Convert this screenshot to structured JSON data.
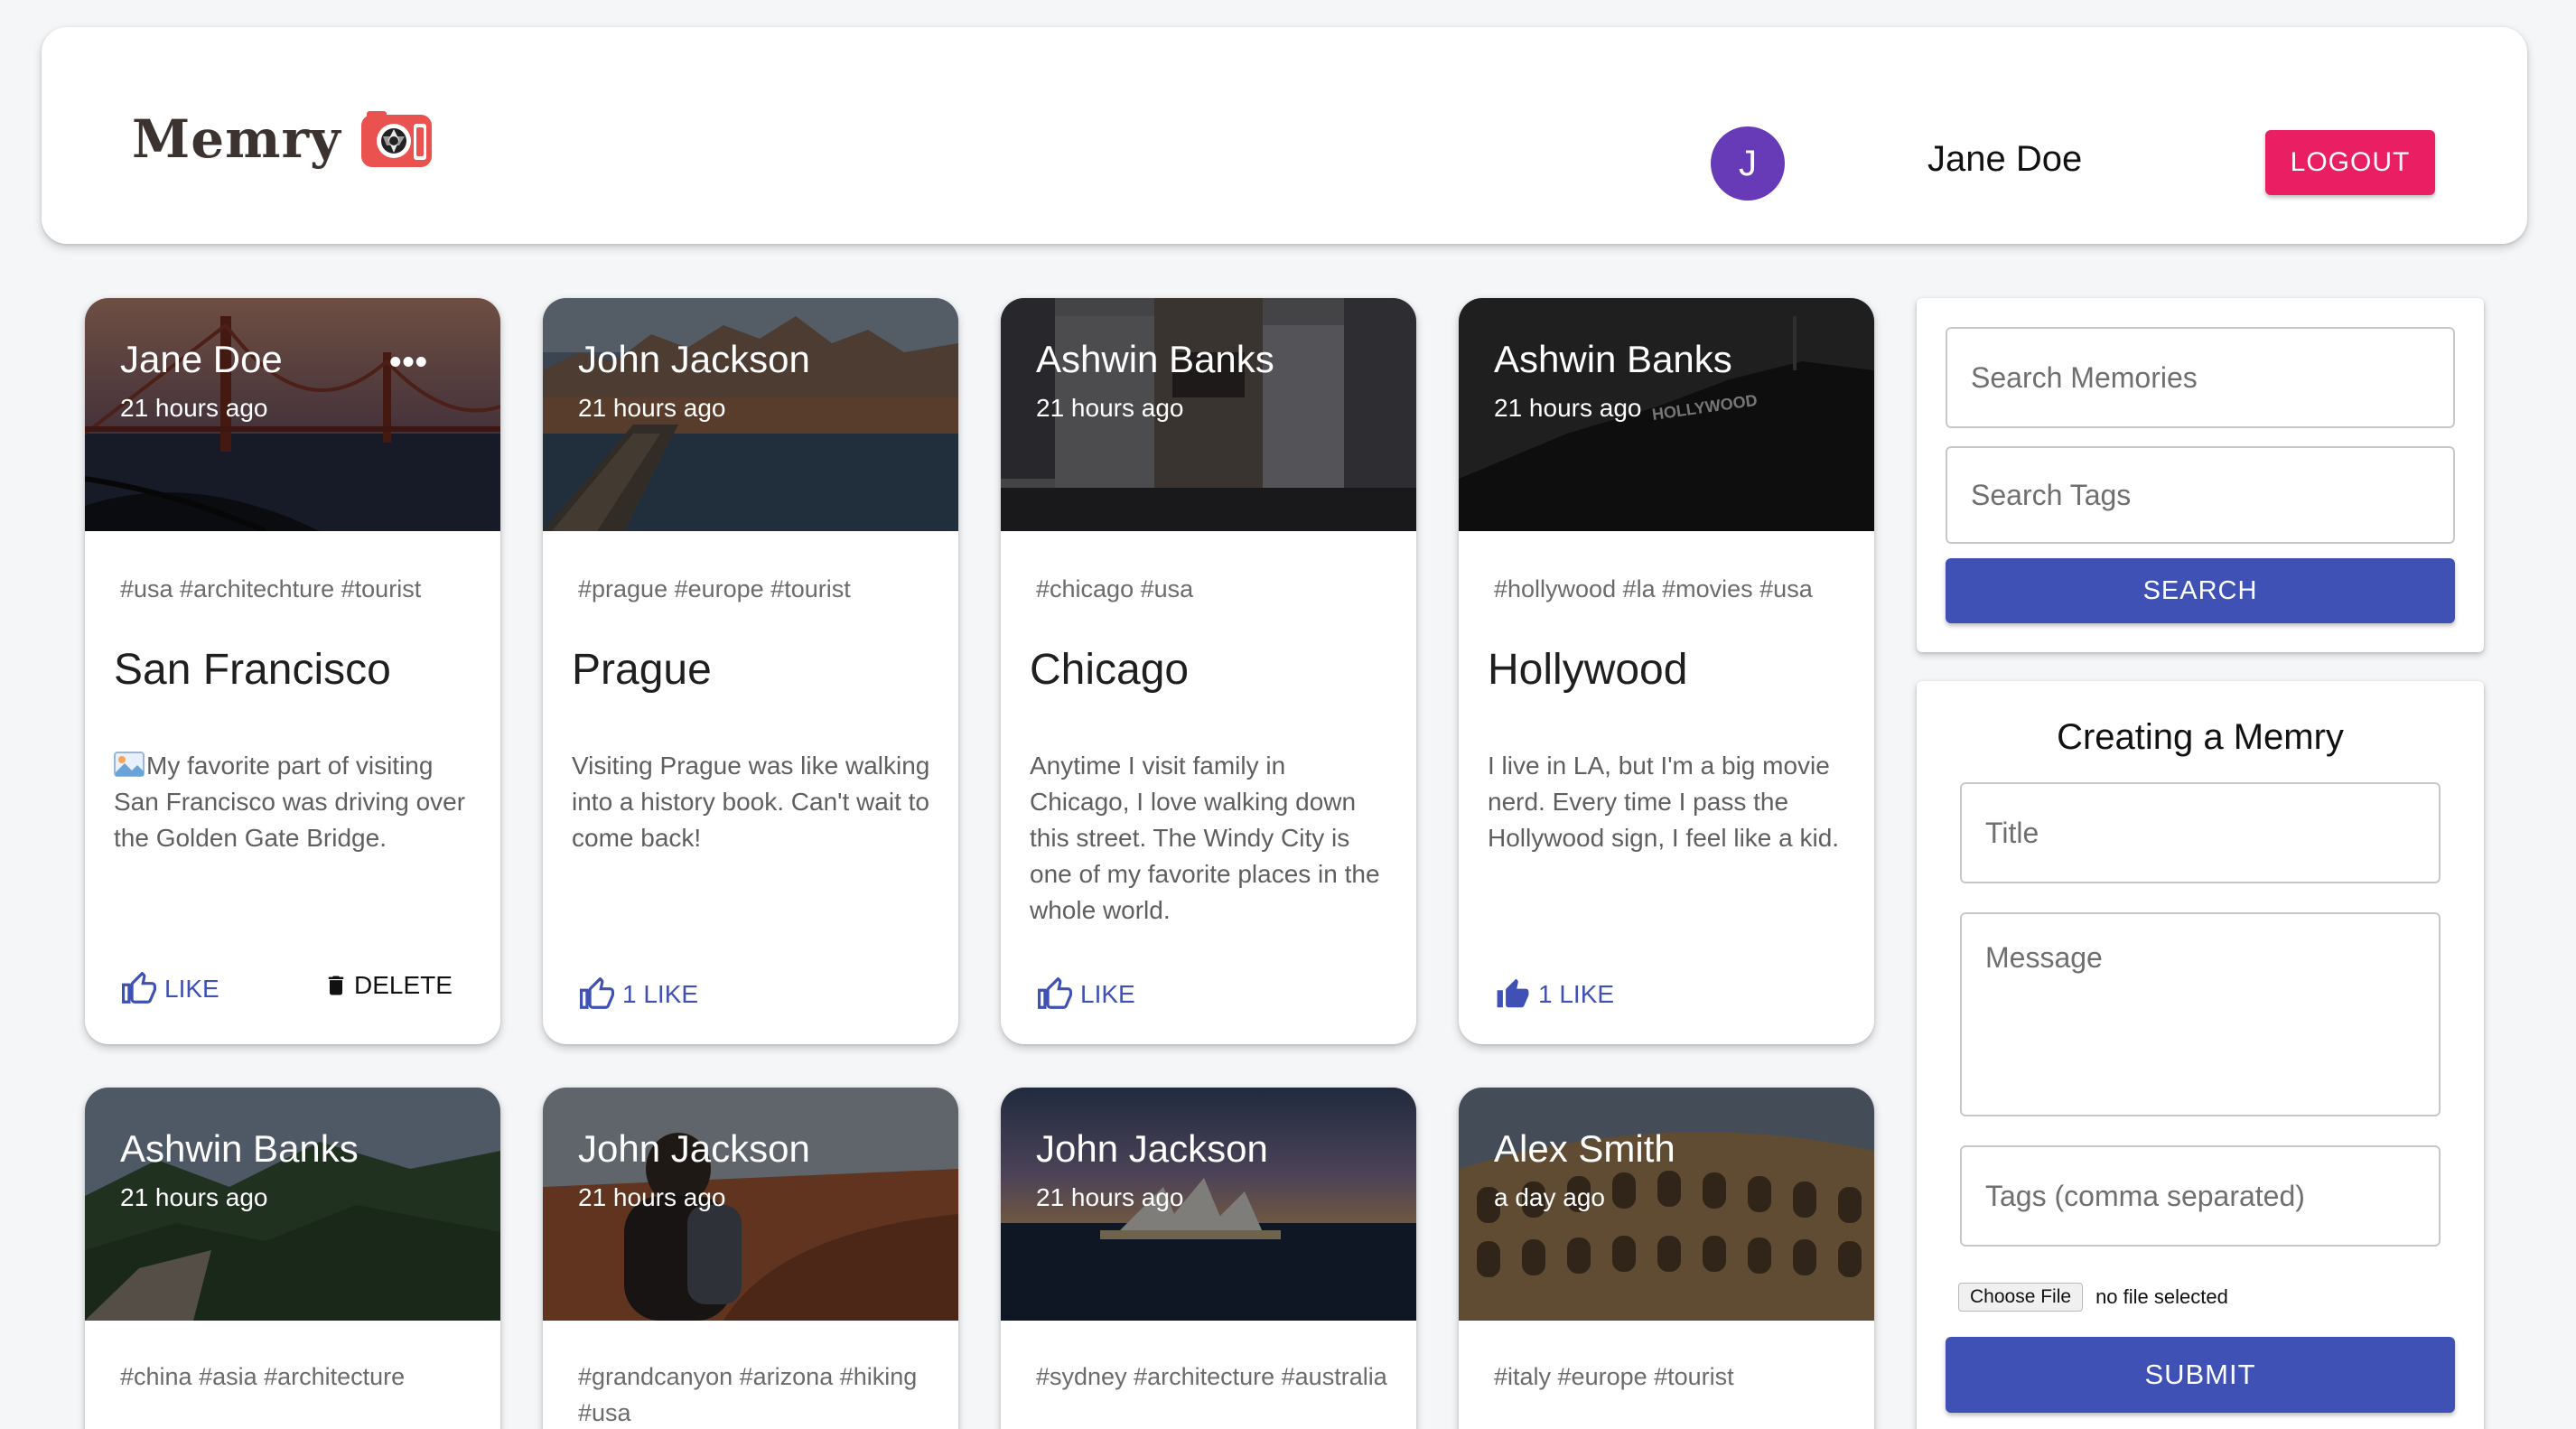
{
  "brand": {
    "name": "Memry",
    "logo_icon": "camera-icon"
  },
  "user": {
    "initial": "J",
    "name": "Jane Doe"
  },
  "header": {
    "logout_label": "LOGOUT"
  },
  "colors": {
    "primary": "#3f51b5",
    "accent": "#e91e63",
    "avatar": "#673ab7"
  },
  "posts": [
    {
      "author": "Jane Doe",
      "time": "21 hours ago",
      "tags": "#usa #architechture #tourist",
      "title": "San Francisco",
      "message": "My favorite part of visiting San Francisco was driving over the Golden Gate Bridge.",
      "like_label": "LIKE",
      "delete_label": "DELETE",
      "has_more": true,
      "liked": false
    },
    {
      "author": "John Jackson",
      "time": "21 hours ago",
      "tags": "#prague #europe #tourist",
      "title": "Prague",
      "message": "Visiting Prague was like walking into a history book. Can't wait to come back!",
      "like_label": "1 LIKE",
      "liked": false
    },
    {
      "author": "Ashwin Banks",
      "time": "21 hours ago",
      "tags": "#chicago #usa",
      "title": "Chicago",
      "message": "Anytime I visit family in Chicago, I love walking down this street. The Windy City is one of my favorite places in the whole world.",
      "like_label": "LIKE",
      "liked": false
    },
    {
      "author": "Ashwin Banks",
      "time": "21 hours ago",
      "tags": "#hollywood #la #movies #usa",
      "title": "Hollywood",
      "message": "I live in LA, but I'm a big movie nerd. Every time I pass the Hollywood sign, I feel like a kid.",
      "like_label": "1 LIKE",
      "liked": true
    },
    {
      "author": "Ashwin Banks",
      "time": "21 hours ago",
      "tags": "#china #asia #architecture"
    },
    {
      "author": "John Jackson",
      "time": "21 hours ago",
      "tags": "#grandcanyon #arizona #hiking #usa"
    },
    {
      "author": "John Jackson",
      "time": "21 hours ago",
      "tags": "#sydney #architecture #australia"
    },
    {
      "author": "Alex Smith",
      "time": "a day ago",
      "tags": "#italy #europe #tourist"
    }
  ],
  "search": {
    "memories_placeholder": "Search Memories",
    "tags_placeholder": "Search Tags",
    "button_label": "SEARCH"
  },
  "form": {
    "heading": "Creating a Memry",
    "title_placeholder": "Title",
    "message_placeholder": "Message",
    "tags_placeholder": "Tags (comma separated)",
    "file_button_label": "Choose File",
    "file_status": "no file selected",
    "submit_label": "SUBMIT"
  },
  "hollywood_sign_text": "HOLLYWOOD"
}
